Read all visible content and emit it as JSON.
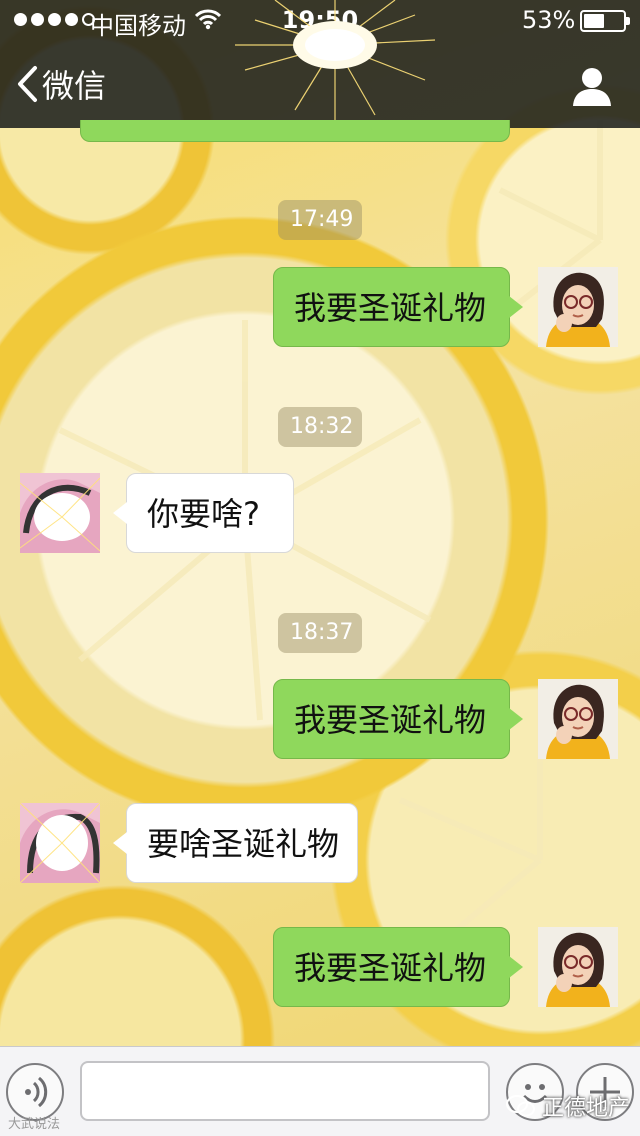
{
  "status_bar": {
    "carrier": "中国移动",
    "time": "19:50",
    "battery_percent": "53%",
    "battery_level": 0.53,
    "signal_bars": 4,
    "signal_max": 5
  },
  "nav": {
    "back_label": "微信",
    "back_icon": "chevron-left-icon",
    "contact_icon": "person-icon"
  },
  "messages": [
    {
      "type": "time",
      "text": "17:49"
    },
    {
      "type": "sent",
      "text": "我要圣诞礼物"
    },
    {
      "type": "time",
      "text": "18:32"
    },
    {
      "type": "received",
      "text": "你要啥?"
    },
    {
      "type": "time",
      "text": "18:37"
    },
    {
      "type": "sent",
      "text": "我要圣诞礼物"
    },
    {
      "type": "received",
      "text": "要啥圣诞礼物"
    },
    {
      "type": "sent",
      "text": "我要圣诞礼物"
    }
  ],
  "input_bar": {
    "voice_icon": "voice-icon",
    "emoji_icon": "smiley-icon",
    "plus_icon": "plus-icon",
    "text_value": ""
  },
  "watermarks": {
    "left": "大武说法",
    "right": "正德地产"
  },
  "colors": {
    "sent_bubble": "#8fd85c",
    "received_bubble": "#ffffff",
    "nav_background": "#1e201e"
  }
}
